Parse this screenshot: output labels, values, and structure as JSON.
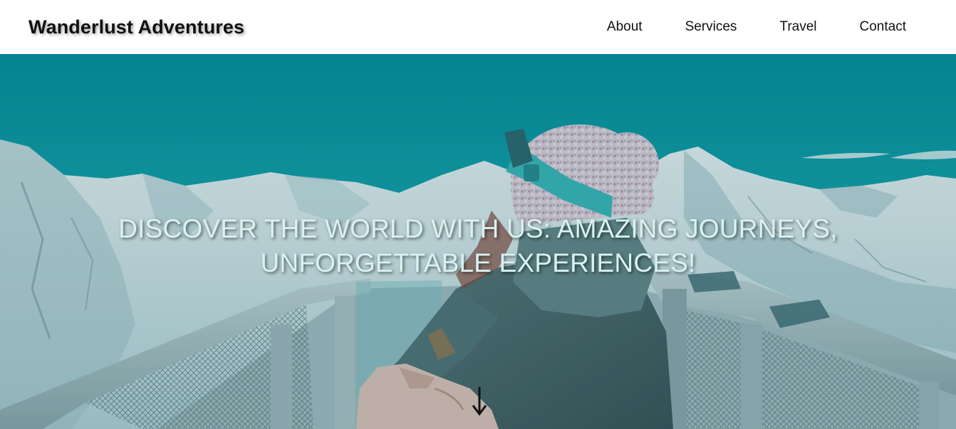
{
  "site": {
    "brand": "Wanderlust Adventures"
  },
  "nav": {
    "items": [
      {
        "label": "About"
      },
      {
        "label": "Services"
      },
      {
        "label": "Travel"
      },
      {
        "label": "Contact"
      }
    ]
  },
  "hero": {
    "title_line1": "DISCOVER THE WORLD WITH US: AMAZING JOURNEYS,",
    "title_line2": "UNFORGETTABLE EXPERIENCES!",
    "scroll_icon": "arrow-down-icon"
  },
  "colors": {
    "sky": "#0aa1ad",
    "hero_text": "#d9f2f1",
    "nav_text": "#111111",
    "nav_bg": "#ffffff"
  }
}
